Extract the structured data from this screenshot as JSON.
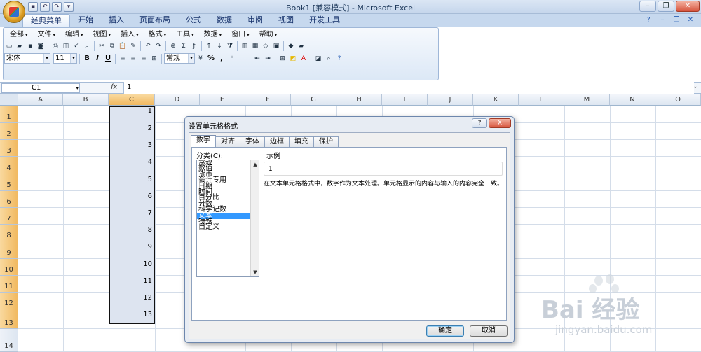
{
  "window": {
    "title": "Book1  [兼容模式] - Microsoft Excel"
  },
  "ribbon": {
    "tabs": [
      "经典菜单",
      "开始",
      "插入",
      "页面布局",
      "公式",
      "数据",
      "审阅",
      "视图",
      "开发工具"
    ],
    "menu": [
      "全部",
      "文件",
      "编辑",
      "视图",
      "插入",
      "格式",
      "工具",
      "数据",
      "窗口",
      "帮助"
    ],
    "font_name": "宋体",
    "font_size": "11",
    "number_format": "常规",
    "bold": "B",
    "italic": "I",
    "underline": "U",
    "percent": "%",
    "comma": ","
  },
  "formula_bar": {
    "name_box": "C1",
    "fx": "fx",
    "value": "1"
  },
  "grid": {
    "columns": [
      "A",
      "B",
      "C",
      "D",
      "E",
      "F",
      "G",
      "H",
      "I",
      "J",
      "K",
      "L",
      "M",
      "N",
      "O"
    ],
    "selected_column": "C",
    "rows": [
      "1",
      "2",
      "3",
      "4",
      "5",
      "6",
      "7",
      "8",
      "9",
      "10",
      "11",
      "12",
      "13",
      "14"
    ],
    "column_c_values": [
      "1",
      "2",
      "3",
      "4",
      "5",
      "6",
      "7",
      "8",
      "9",
      "10",
      "11",
      "12",
      "13"
    ]
  },
  "dialog": {
    "title": "设置单元格格式",
    "help": "?",
    "close": "X",
    "tabs": [
      "数字",
      "对齐",
      "字体",
      "边框",
      "填充",
      "保护"
    ],
    "active_tab": "数字",
    "category_label": "分类(C):",
    "categories": [
      "常规",
      "数值",
      "货币",
      "会计专用",
      "日期",
      "时间",
      "百分比",
      "分数",
      "科学记数",
      "文本",
      "特殊",
      "自定义"
    ],
    "selected_category": "文本",
    "sample_label": "示例",
    "sample_value": "1",
    "description": "在文本单元格格式中，数字作为文本处理。单元格显示的内容与输入的内容完全一致。",
    "ok_label": "确定",
    "cancel_label": "取消"
  },
  "watermark": {
    "brand": "Bai 经验",
    "sub": "jingyan.baidu.com"
  }
}
